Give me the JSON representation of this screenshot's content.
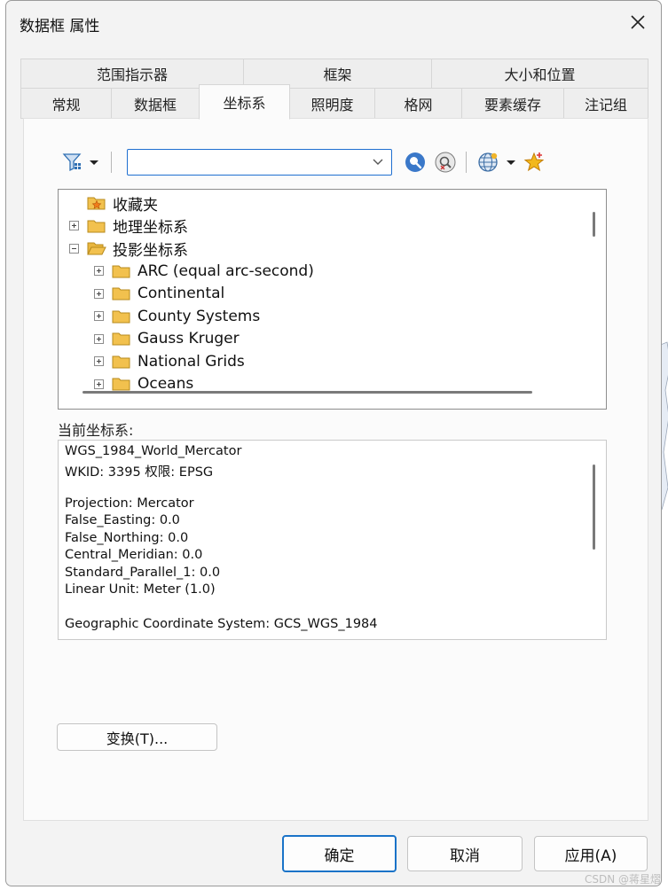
{
  "dialog": {
    "title": "数据框 属性"
  },
  "tabs": {
    "row_top": [
      "范围指示器",
      "框架",
      "大小和位置"
    ],
    "row_bottom": [
      "常规",
      "数据框",
      "坐标系",
      "照明度",
      "格网",
      "要素缓存",
      "注记组"
    ],
    "active": "坐标系"
  },
  "toolbar": {
    "search": {
      "value": "",
      "placeholder": ""
    },
    "icons": [
      "filter-icon",
      "dropdown-arrow-icon",
      "search-icon",
      "clear-search-icon",
      "globe-icon",
      "favorite-add-icon"
    ]
  },
  "tree": {
    "items": [
      {
        "label": "收藏夹",
        "level": 0,
        "expander": "none",
        "icon": "favorites-folder-icon"
      },
      {
        "label": "地理坐标系",
        "level": 0,
        "expander": "plus",
        "icon": "folder-icon"
      },
      {
        "label": "投影坐标系",
        "level": 0,
        "expander": "minus",
        "icon": "folder-open-icon"
      },
      {
        "label": "ARC (equal arc-second)",
        "level": 1,
        "expander": "plus",
        "icon": "folder-icon"
      },
      {
        "label": "Continental",
        "level": 1,
        "expander": "plus",
        "icon": "folder-icon"
      },
      {
        "label": "County Systems",
        "level": 1,
        "expander": "plus",
        "icon": "folder-icon"
      },
      {
        "label": "Gauss Kruger",
        "level": 1,
        "expander": "plus",
        "icon": "folder-icon"
      },
      {
        "label": "National Grids",
        "level": 1,
        "expander": "plus",
        "icon": "folder-icon"
      },
      {
        "label": "Oceans",
        "level": 1,
        "expander": "plus",
        "icon": "folder-icon"
      }
    ]
  },
  "current": {
    "label": "当前坐标系:",
    "lines": [
      "WGS_1984_World_Mercator",
      "WKID: 3395 权限: EPSG",
      "",
      "Projection: Mercator",
      "False_Easting: 0.0",
      "False_Northing: 0.0",
      "Central_Meridian: 0.0",
      "Standard_Parallel_1: 0.0",
      "Linear Unit: Meter (1.0)",
      "",
      "Geographic Coordinate System: GCS_WGS_1984"
    ]
  },
  "buttons": {
    "transform": "变换(T)...",
    "ok": "确定",
    "cancel": "取消",
    "apply": "应用(A)"
  },
  "watermark": "CSDN @蒋星熠",
  "colors": {
    "accent": "#1a73c8",
    "folder": "#f2c14e"
  }
}
